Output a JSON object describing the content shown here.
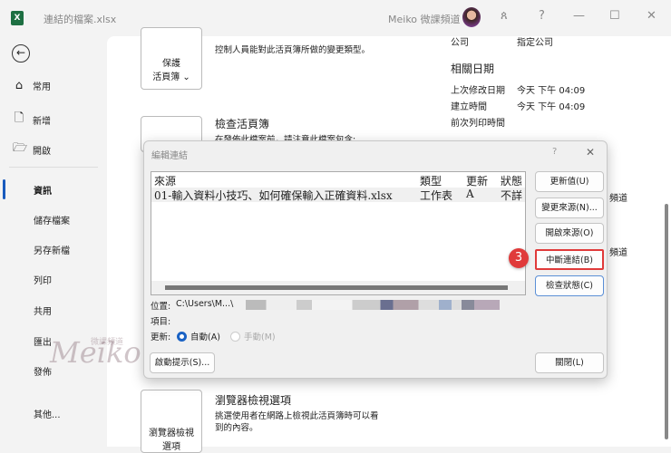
{
  "titlebar": {
    "app_icon": "X",
    "filename": "連結的檔案.xlsx",
    "user": "Meiko 微課頻道",
    "icons": [
      "coauthor-icon",
      "help-icon",
      "minimize-icon",
      "maximize-icon",
      "close-icon"
    ],
    "help": "?",
    "min": "—",
    "max": "☐",
    "close": "✕",
    "coauthor": "ጰ"
  },
  "sidebar": {
    "back": "←",
    "items": [
      {
        "label": "常用",
        "icon": "⌂"
      },
      {
        "label": "新增",
        "icon": "🗋"
      },
      {
        "label": "開啟",
        "icon": "🗁"
      }
    ],
    "items2": [
      "資訊",
      "儲存檔案",
      "另存新檔",
      "列印",
      "共用",
      "匯出",
      "發佈"
    ],
    "more": "其他..."
  },
  "main": {
    "protect": {
      "label1": "保護",
      "label2": "活頁簿",
      "chevron": "⌄",
      "desc": "控制人員能對此活頁簿所做的變更類型。"
    },
    "inspect": {
      "title": "檢查活頁簿",
      "desc": "在發佈此檔案前，請注意此檔案包含:"
    },
    "browser": {
      "label1": "瀏覽器檢視",
      "label2": "選項",
      "title": "瀏覽器檢視選項",
      "desc1": "挑選使用者在網路上檢視此活頁簿時可以看",
      "desc2": "到的內容。"
    },
    "props": {
      "company_label": "公司",
      "company_value": "指定公司",
      "dates_title": "相關日期",
      "modified_label": "上次修改日期",
      "modified_value": "今天 下午 04:09",
      "created_label": "建立時間",
      "created_value": "今天 下午 04:09",
      "printed_label": "前次列印時間"
    },
    "partial1": "頻道",
    "partial2": "頻道"
  },
  "dialog": {
    "title": "編輯連結",
    "help": "?",
    "close": "✕",
    "columns": [
      "來源",
      "類型",
      "更新",
      "狀態"
    ],
    "rows": [
      [
        "01-輸入資料小技巧、如何確保輸入正確資料.xlsx",
        "工作表",
        "A",
        "不詳"
      ]
    ],
    "buttons": {
      "update": "更新值(U)",
      "change": "變更來源(N)...",
      "open": "開啟來源(O)",
      "break": "中斷連結(B)",
      "check": "檢查狀態(C)",
      "startup": "啟動提示(S)...",
      "close": "關閉(L)"
    },
    "location_label": "位置:",
    "location_value": "C:\\Users\\M...\\",
    "item_label": "項目:",
    "update_label": "更新:",
    "auto": "自動(A)",
    "manual": "手動(M)"
  },
  "annotation": {
    "step": "3",
    "color": "#e03a3a"
  },
  "watermark": {
    "text": "Meiko",
    "sub": "微課頻道"
  }
}
